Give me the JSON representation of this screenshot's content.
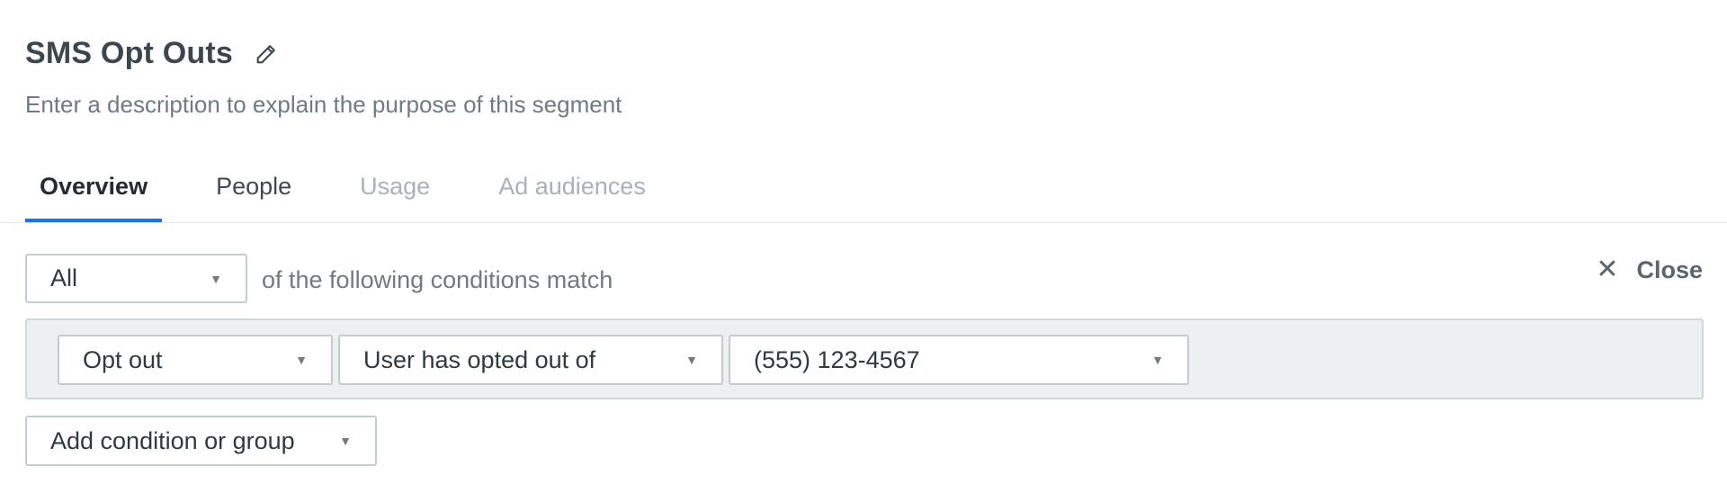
{
  "segment": {
    "title": "SMS Opt Outs",
    "description_placeholder": "Enter a description to explain the purpose of this segment"
  },
  "tabs": [
    {
      "label": "Overview",
      "state": "active"
    },
    {
      "label": "People",
      "state": "normal"
    },
    {
      "label": "Usage",
      "state": "disabled"
    },
    {
      "label": "Ad audiences",
      "state": "disabled"
    }
  ],
  "conditions": {
    "match_select": {
      "value": "All"
    },
    "match_text": "of the following conditions match",
    "close_label": "Close",
    "rows": [
      {
        "type": "Opt out",
        "operator": "User has opted out of",
        "value": "(555) 123-4567"
      }
    ],
    "add_button": "Add condition or group"
  },
  "icons": {
    "edit": "pencil-icon",
    "close": "close-icon",
    "caret": "chevron-down-icon"
  },
  "colors": {
    "accent": "#1a73e8",
    "group_background": "#ecf0f0"
  }
}
